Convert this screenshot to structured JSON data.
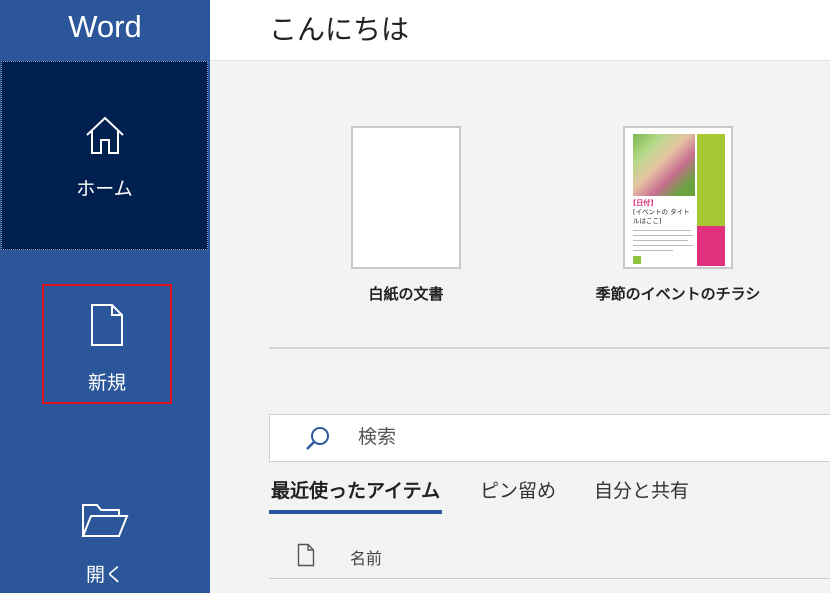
{
  "app": {
    "title": "Word"
  },
  "sidebar": {
    "items": [
      {
        "id": "home",
        "label": "ホーム",
        "icon": "home-icon"
      },
      {
        "id": "new",
        "label": "新規",
        "icon": "new-document-icon"
      },
      {
        "id": "open",
        "label": "開く",
        "icon": "folder-open-icon"
      }
    ]
  },
  "header": {
    "greeting": "こんにちは"
  },
  "templates": [
    {
      "label": "白紙の文書"
    },
    {
      "label": "季節のイベントのチラシ",
      "thumbnail": {
        "date": "[日付]",
        "title": "[イベントの タイトルはここ]"
      }
    }
  ],
  "search": {
    "placeholder": "検索"
  },
  "tabs": [
    {
      "label": "最近使ったアイテム",
      "active": true
    },
    {
      "label": "ピン留め",
      "active": false
    },
    {
      "label": "自分と共有",
      "active": false
    }
  ],
  "file_list": {
    "column_name": "名前"
  },
  "colors": {
    "sidebar": "#2b579a",
    "sidebar_selected": "#002050",
    "highlight_border": "#e0141e",
    "accent": "#2b579a"
  }
}
